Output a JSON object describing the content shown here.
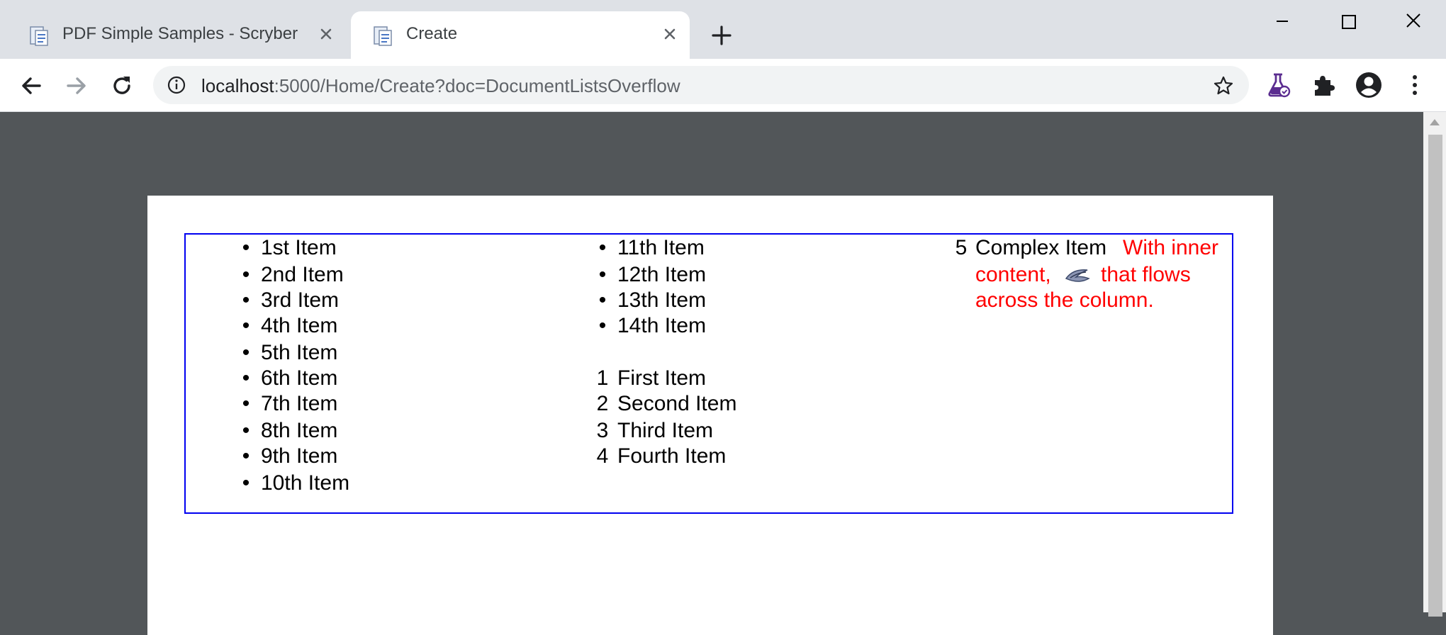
{
  "tabs": [
    {
      "title": "PDF Simple Samples - Scryber",
      "active": false
    },
    {
      "title": "Create",
      "active": true
    }
  ],
  "omnibox": {
    "url_host": "localhost",
    "url_rest": ":5000/Home/Create?doc=DocumentListsOverflow"
  },
  "document": {
    "bullet_glyph": "•",
    "column1": [
      "1st Item",
      "2nd Item",
      "3rd Item",
      "4th Item",
      "5th Item",
      "6th Item",
      "7th Item",
      "8th Item",
      "9th Item",
      "10th Item"
    ],
    "column2_bullets": [
      "11th Item",
      "12th Item",
      "13th Item",
      "14th Item"
    ],
    "column2_numbered": [
      {
        "num": "1",
        "text": "First Item"
      },
      {
        "num": "2",
        "text": "Second Item"
      },
      {
        "num": "3",
        "text": "Third Item"
      },
      {
        "num": "4",
        "text": "Fourth Item"
      }
    ],
    "complex": {
      "num": "5",
      "label": "Complex Item",
      "red_line1": "With inner",
      "red_line2a": "content,",
      "red_line2b": "that flows",
      "red_line3": "across the column."
    }
  },
  "colors": {
    "border": "#0000f0",
    "red": "#ff0000",
    "viewer_bg": "#525659"
  }
}
